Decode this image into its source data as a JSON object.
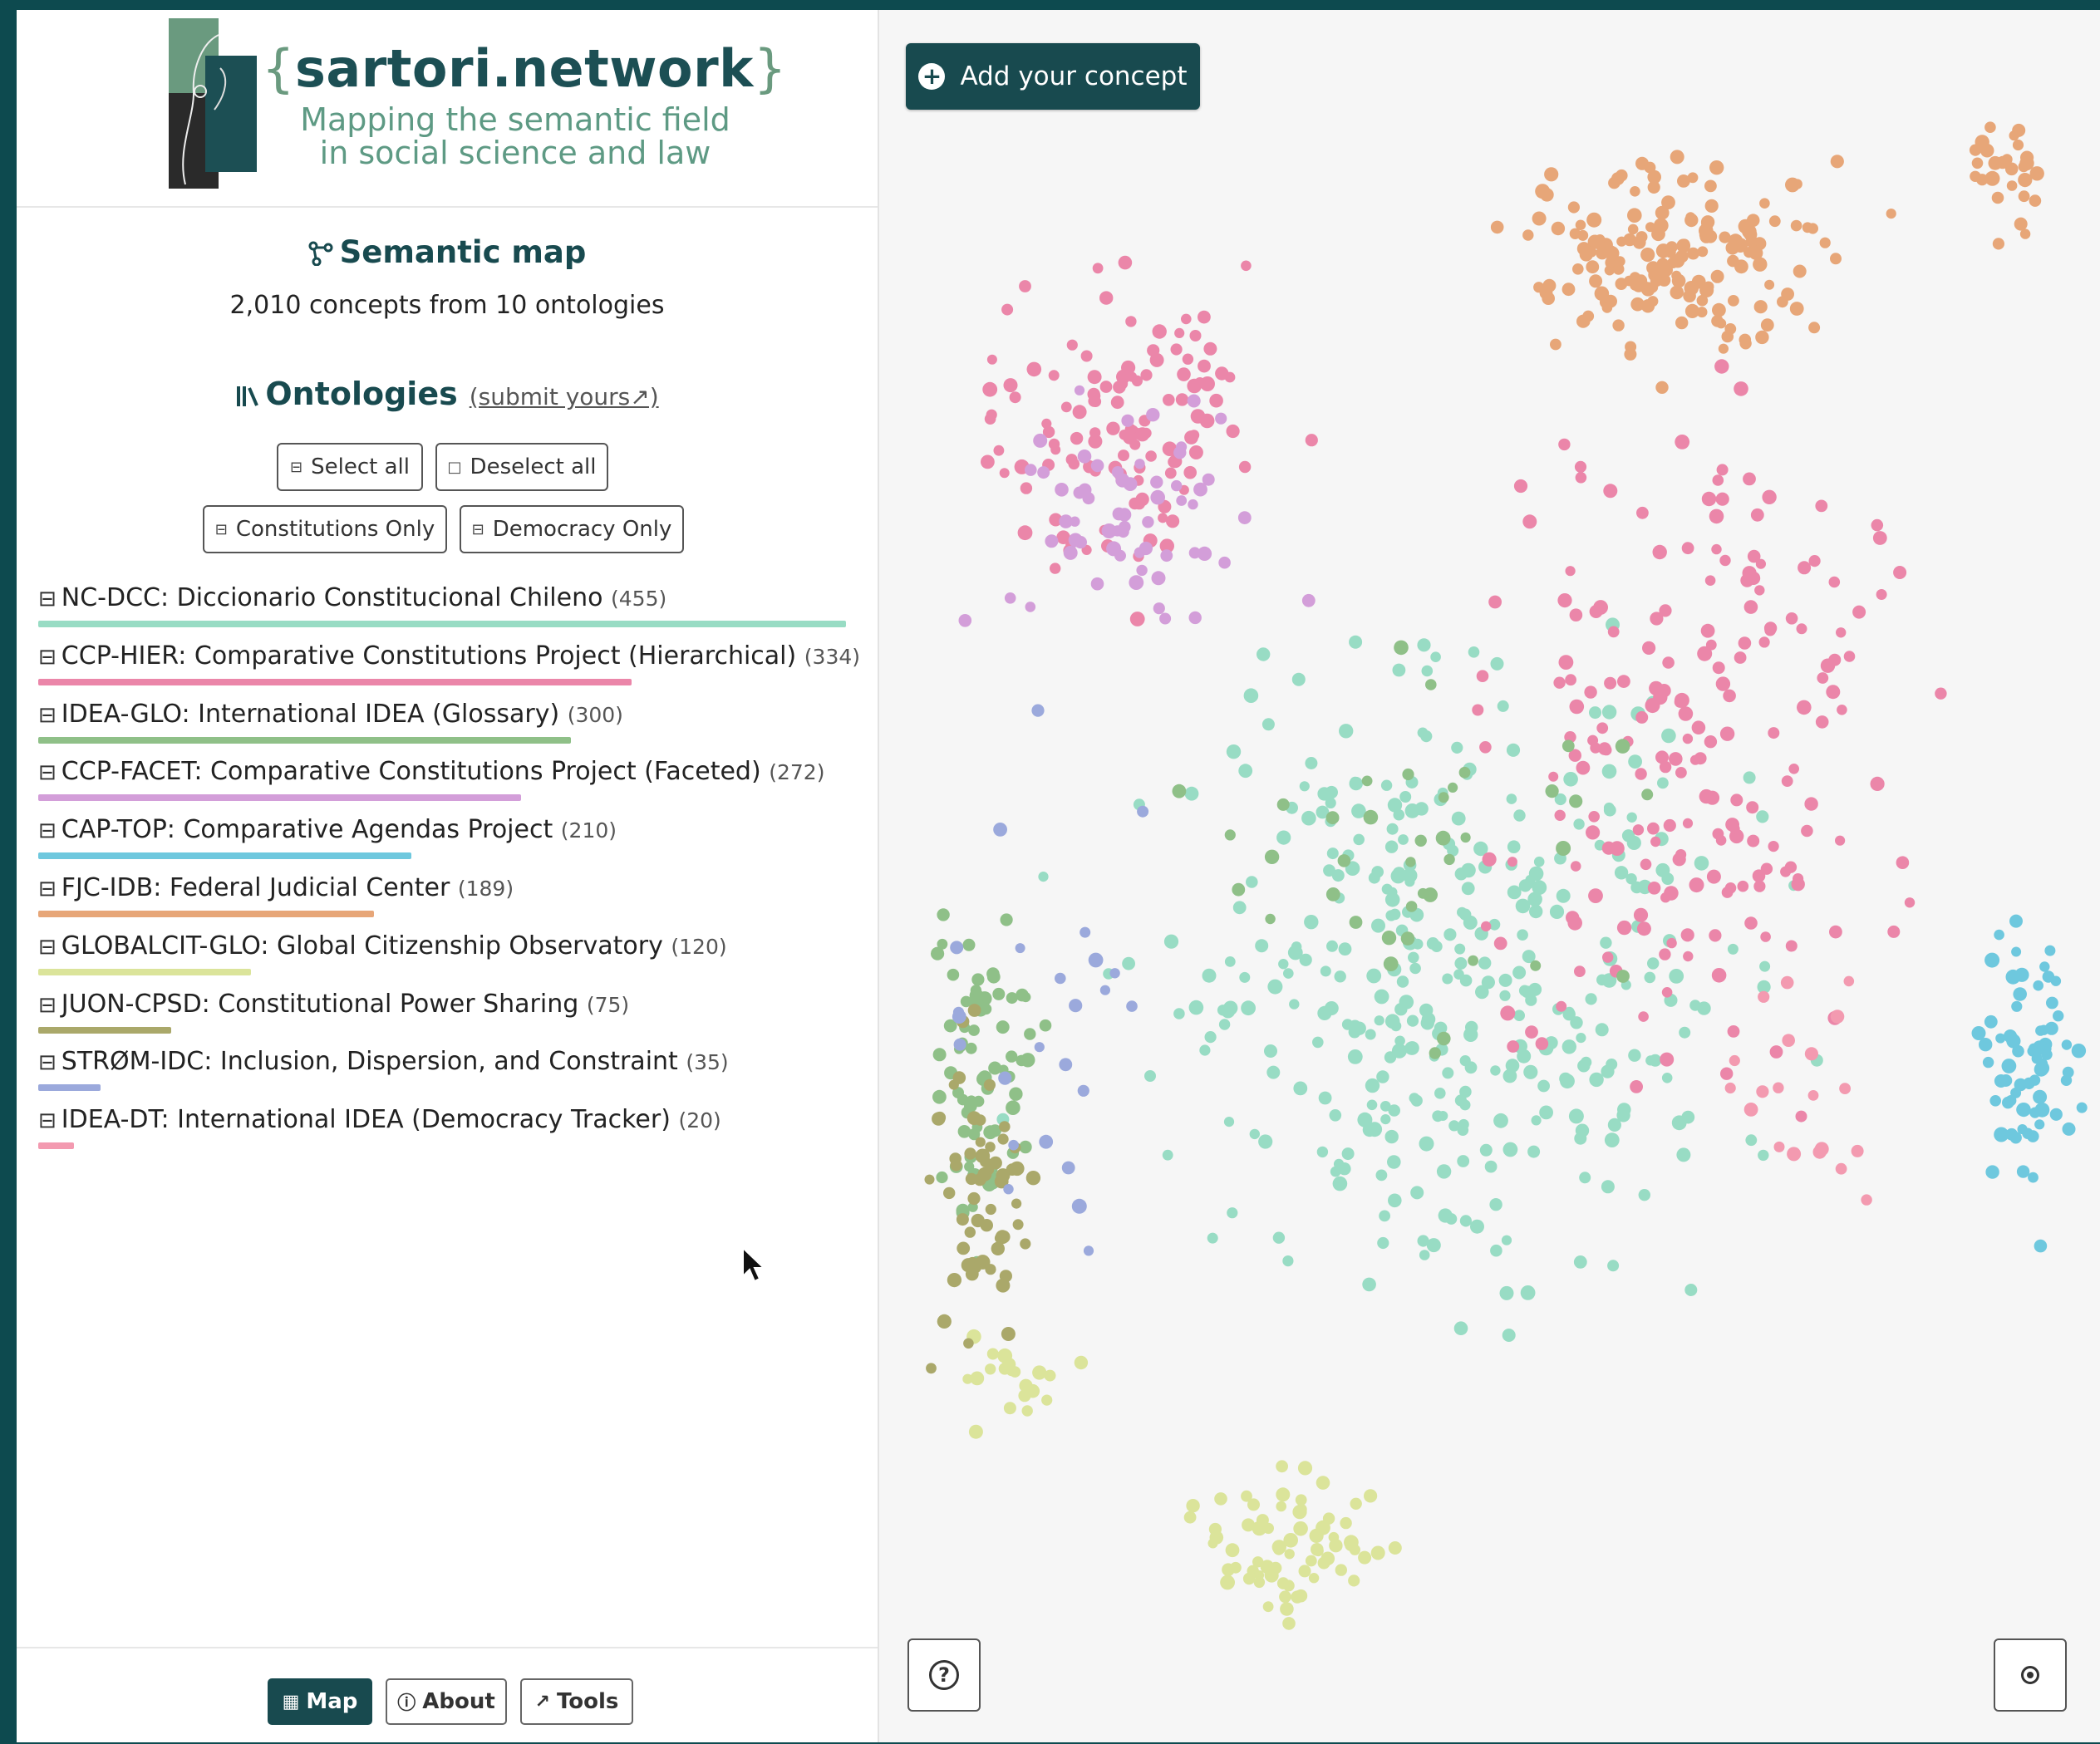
{
  "header": {
    "brand_open": "{",
    "brand_name": "sartori.network",
    "brand_close": "}",
    "tagline_line1": "Mapping the semantic field",
    "tagline_line2": "in social science and law"
  },
  "summary": {
    "title": "Semantic map",
    "subtitle": "2,010 concepts from 10 ontologies"
  },
  "ontologies_section": {
    "title": "Ontologies",
    "submit_link": "(submit yours↗)",
    "select_all": "Select all",
    "deselect_all": "Deselect all",
    "constitutions_only": "Constitutions Only",
    "democracy_only": "Democracy Only"
  },
  "ontologies": [
    {
      "label": "NC-DCC: Diccionario Constitucional Chileno",
      "count": "(455)",
      "value": 455,
      "color": "#98dcc4"
    },
    {
      "label": "CCP-HIER: Comparative Constitutions Project (Hierarchical)",
      "count": "(334)",
      "value": 334,
      "color": "#eb86a9"
    },
    {
      "label": "IDEA-GLO: International IDEA (Glossary)",
      "count": "(300)",
      "value": 300,
      "color": "#8fc088"
    },
    {
      "label": "CCP-FACET: Comparative Constitutions Project (Faceted)",
      "count": "(272)",
      "value": 272,
      "color": "#d39ed9"
    },
    {
      "label": "CAP-TOP: Comparative Agendas Project",
      "count": "(210)",
      "value": 210,
      "color": "#6ec8de"
    },
    {
      "label": "FJC-IDB: Federal Judicial Center",
      "count": "(189)",
      "value": 189,
      "color": "#e7a678"
    },
    {
      "label": "GLOBALCIT-GLO: Global Citizenship Observatory",
      "count": "(120)",
      "value": 120,
      "color": "#dbe49a"
    },
    {
      "label": "JUON-CPSD: Constitutional Power Sharing",
      "count": "(75)",
      "value": 75,
      "color": "#aaa86a"
    },
    {
      "label": "STRØM-IDC: Inclusion, Dispersion, and Constraint",
      "count": "(35)",
      "value": 35,
      "color": "#9ba9dc"
    },
    {
      "label": "IDEA-DT: International IDEA (Democracy Tracker)",
      "count": "(20)",
      "value": 20,
      "color": "#f39ab0"
    }
  ],
  "footer": {
    "map": "Map",
    "about": "About",
    "tools": "Tools"
  },
  "map": {
    "add_concept": "Add your concept",
    "help": "?"
  },
  "icons": {
    "semantic_map": "graph-icon",
    "ontologies": "library-icon",
    "select": "checkbox-icon",
    "add": "plus-circle-icon",
    "help": "question-icon",
    "recenter": "target-icon",
    "map": "map-icon",
    "about": "info-icon",
    "tools": "external-link-icon"
  }
}
